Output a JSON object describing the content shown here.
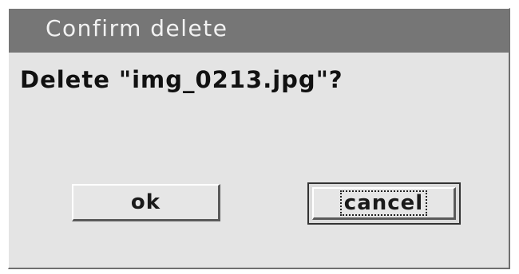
{
  "dialog": {
    "title": "Confirm delete",
    "message": "Delete \"img_0213.jpg\"?",
    "buttons": {
      "ok_label": "ok",
      "cancel_label": "cancel"
    }
  }
}
